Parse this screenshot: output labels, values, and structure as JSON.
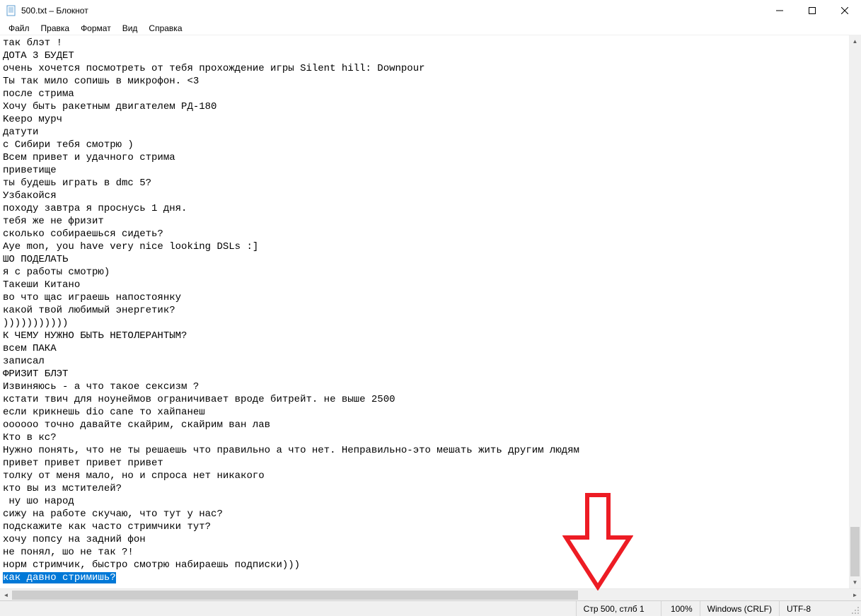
{
  "window": {
    "title": "500.txt – Блокнот"
  },
  "menu": {
    "file": "Файл",
    "edit": "Правка",
    "format": "Формат",
    "view": "Вид",
    "help": "Справка"
  },
  "content": {
    "lines": [
      "так блэт !",
      "ДОТА 3 БУДЕТ",
      "очень хочется посмотреть от тебя прохождение игры Silent hill: Downpour",
      "Ты так мило сопишь в микрофон. <3",
      "после стрима",
      "Хочу быть ракетным двигателем РД-180",
      "Keepo мурч",
      "датути",
      "с Сибири тебя смотрю )",
      "Всем привет и удачного стрима",
      "приветище",
      "ты будешь играть в dmc 5?",
      "Узбакойся",
      "походу завтра я проснусь 1 дня.",
      "тебя же не фризит",
      "сколько собираешься сидеть?",
      "Aye mon, you have very nice looking DSLs :]",
      "ШО ПОДЕЛАТЬ",
      "я с работы смотрю)",
      "Такеши Китано",
      "во что щас играешь напостоянку",
      "какой твой любимый энергетик?",
      ")))))))))))",
      "К ЧЕМУ НУЖНО БЫТЬ НЕТОЛЕРАНТЫМ?",
      "всем ПАКА",
      "записал",
      "ФРИЗИТ БЛЭТ",
      "Извиняюсь - а что такое сексизм ?",
      "кстати твич для ноунеймов ограничивает вроде битрейт. не выше 2500",
      "если крикнешь dio cane то хайпанеш",
      "оооооо точно давайте скайрим, скайрим ван лав",
      "Кто в кс?",
      "Нужно понять, что не ты решаешь что правильно а что нет. Неправильно-это мешать жить другим людям",
      "привет привет привет привет",
      "толку от меня мало, но и спроса нет никакого",
      "кто вы из мстителей?",
      " ну шо народ",
      "сижу на работе скучаю, что тут у нас?",
      "подскажите как часто стримчики тут?",
      "хочу попсу на задний фон",
      "не понял, шо не так ?!",
      "норм стримчик, быстро смотрю набираешь подписки)))"
    ],
    "selected_line": "как давно стримишь?"
  },
  "status": {
    "position": "Стр 500, стлб 1",
    "zoom": "100%",
    "eol": "Windows (CRLF)",
    "encoding": "UTF-8"
  },
  "annotation": {
    "arrow_color": "#ed1c24"
  }
}
